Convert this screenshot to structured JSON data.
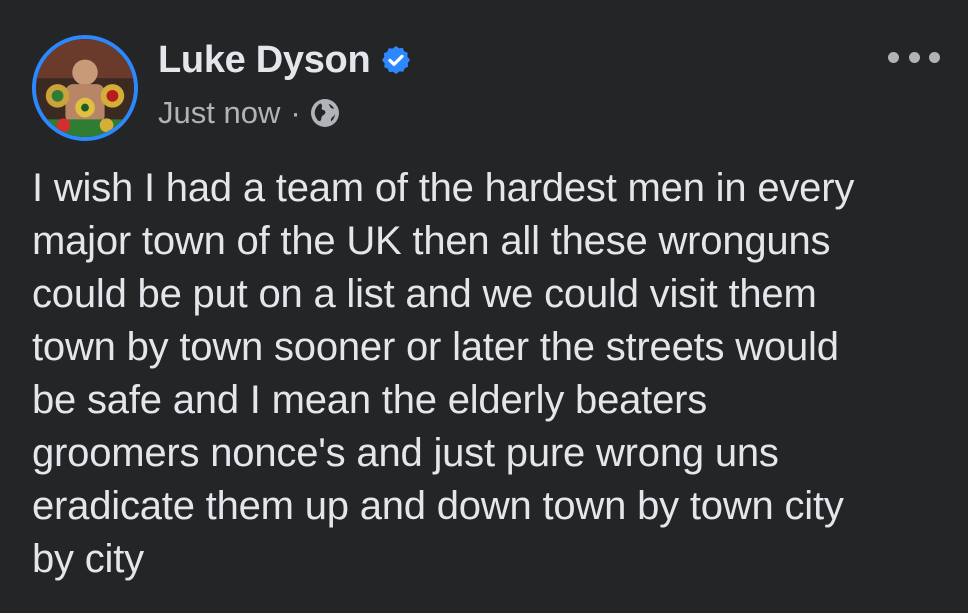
{
  "post": {
    "author_name": "Luke Dyson",
    "verified": true,
    "timestamp": "Just now",
    "separator": "·",
    "privacy_icon": "globe-icon",
    "more_icon": "more-options-icon",
    "text": "I wish I had a team of the hardest men in every\nmajor town of the UK then all these wronguns\ncould be put on a list and we could visit them\ntown by town sooner or later the streets would\nbe safe and I mean  the elderly beaters\ngroomers nonce's and just pure wrong uns\neradicate them up and down town by town city\nby city"
  },
  "colors": {
    "background": "#242526",
    "primary_text": "#e4e6eb",
    "secondary_text": "#b0b3b8",
    "accent": "#2d88ff"
  }
}
